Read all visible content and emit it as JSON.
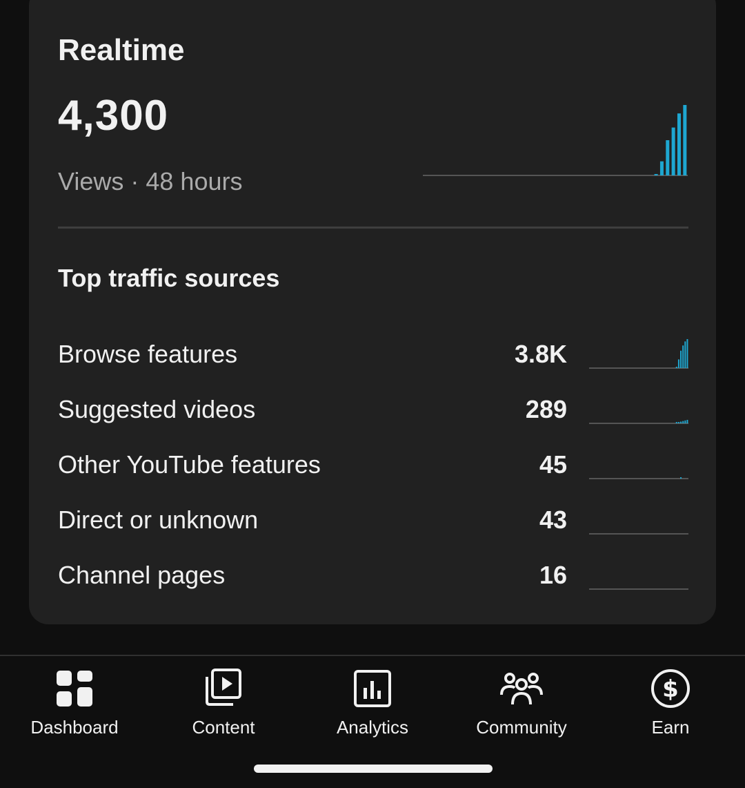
{
  "realtime": {
    "title": "Realtime",
    "total_views": "4,300",
    "subtitle": "Views · 48 hours",
    "accent_color": "#1ea7d1",
    "spark": [
      0,
      0,
      0,
      0,
      0,
      0,
      0,
      0,
      0,
      0,
      0,
      0,
      0,
      0,
      0,
      0,
      0,
      0,
      0,
      0,
      0,
      0,
      0,
      0,
      0,
      0,
      0,
      0,
      0,
      0,
      0,
      0,
      0,
      0,
      0,
      0,
      0,
      0,
      0,
      0,
      0.02,
      0.2,
      0.5,
      0.68,
      0.88,
      1.0
    ]
  },
  "traffic": {
    "title": "Top traffic sources",
    "sources": [
      {
        "name": "Browse features",
        "value": "3.8K",
        "spark": [
          0,
          0,
          0,
          0,
          0,
          0,
          0,
          0,
          0,
          0,
          0,
          0,
          0,
          0,
          0,
          0,
          0,
          0,
          0,
          0,
          0,
          0,
          0,
          0,
          0,
          0,
          0,
          0,
          0,
          0,
          0,
          0,
          0,
          0,
          0,
          0,
          0,
          0,
          0,
          0,
          0.04,
          0.3,
          0.6,
          0.78,
          0.92,
          1.0
        ]
      },
      {
        "name": "Suggested videos",
        "value": "289",
        "spark": [
          0,
          0,
          0,
          0,
          0,
          0,
          0,
          0,
          0,
          0,
          0,
          0,
          0,
          0,
          0,
          0,
          0,
          0,
          0,
          0,
          0,
          0,
          0,
          0,
          0,
          0,
          0,
          0,
          0,
          0,
          0,
          0,
          0,
          0,
          0,
          0,
          0,
          0,
          0,
          0,
          0.02,
          0.04,
          0.06,
          0.08,
          0.1,
          0.12
        ]
      },
      {
        "name": "Other YouTube features",
        "value": "45",
        "spark": [
          0,
          0,
          0,
          0,
          0,
          0,
          0,
          0,
          0,
          0,
          0,
          0,
          0,
          0,
          0,
          0,
          0,
          0,
          0,
          0,
          0,
          0,
          0,
          0,
          0,
          0,
          0,
          0,
          0,
          0,
          0,
          0,
          0,
          0,
          0,
          0,
          0,
          0,
          0,
          0,
          0,
          0,
          0.03,
          0,
          0,
          0
        ]
      },
      {
        "name": "Direct or unknown",
        "value": "43",
        "spark": [
          0,
          0,
          0,
          0,
          0,
          0,
          0,
          0,
          0,
          0,
          0,
          0,
          0,
          0,
          0,
          0,
          0,
          0,
          0,
          0,
          0,
          0,
          0,
          0,
          0,
          0,
          0,
          0,
          0,
          0,
          0,
          0,
          0,
          0,
          0,
          0,
          0,
          0,
          0,
          0,
          0,
          0,
          0,
          0,
          0,
          0
        ]
      },
      {
        "name": "Channel pages",
        "value": "16",
        "spark": [
          0,
          0,
          0,
          0,
          0,
          0,
          0,
          0,
          0,
          0,
          0,
          0,
          0,
          0,
          0,
          0,
          0,
          0,
          0,
          0,
          0,
          0,
          0,
          0,
          0,
          0,
          0,
          0,
          0,
          0,
          0,
          0,
          0,
          0,
          0,
          0,
          0,
          0,
          0,
          0,
          0,
          0,
          0,
          0,
          0,
          0
        ]
      }
    ]
  },
  "nav": {
    "items": [
      {
        "label": "Dashboard",
        "icon": "dashboard-icon"
      },
      {
        "label": "Content",
        "icon": "content-icon"
      },
      {
        "label": "Analytics",
        "icon": "analytics-icon"
      },
      {
        "label": "Community",
        "icon": "community-icon"
      },
      {
        "label": "Earn",
        "icon": "earn-icon"
      }
    ]
  }
}
